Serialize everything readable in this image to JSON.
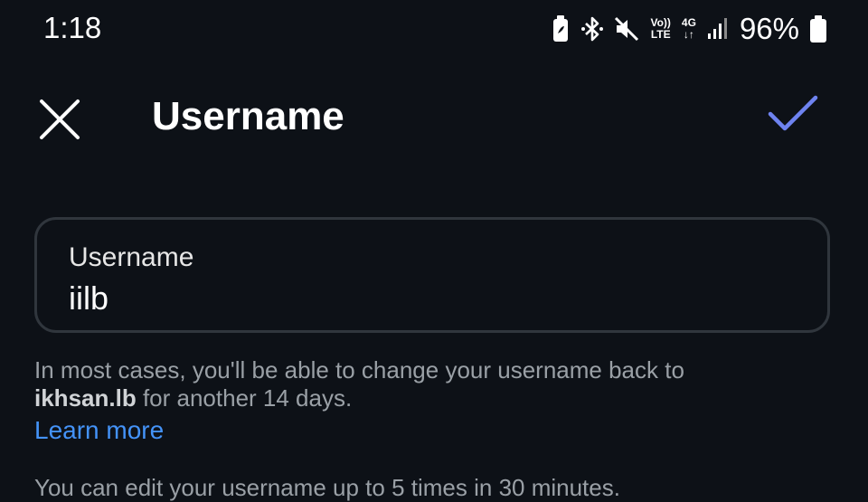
{
  "status_bar": {
    "time": "1:18",
    "volte_top": "Vo))",
    "volte_bottom": "LTE",
    "network_top": "4G",
    "network_bottom": "↓↑",
    "battery_percent": "96%",
    "icons": [
      "battery-saver-icon",
      "bluetooth-icon",
      "mute-icon",
      "volte-icon",
      "network-4g-icon",
      "signal-icon",
      "battery-icon"
    ]
  },
  "app_bar": {
    "title": "Username",
    "close_icon": "close-icon",
    "confirm_icon": "check-icon"
  },
  "username_field": {
    "label": "Username",
    "value": "iilb"
  },
  "helper": {
    "prefix": "In most cases, you'll be able to change your username back to",
    "previous_username": "ikhsan.lb",
    "suffix": "for another 14 days.",
    "learn_more": "Learn more"
  },
  "edit_limit_text": "You can edit your username up to 5 times in 30 minutes.",
  "colors": {
    "background": "#0d1117",
    "accent_check": "#6e83f0",
    "link": "#4493f8",
    "field_border": "#30363d"
  }
}
